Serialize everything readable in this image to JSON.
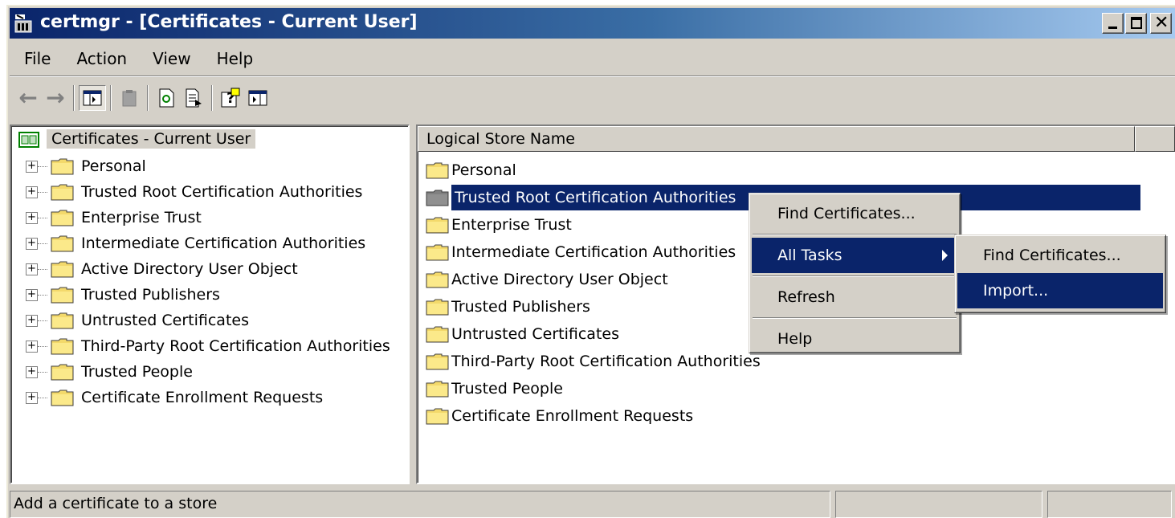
{
  "window": {
    "title": "certmgr - [Certificates - Current User]",
    "icons": {
      "app": "certmgr-icon",
      "minimize": "minimize-icon",
      "maximize": "maximize-icon",
      "close": "close-icon"
    },
    "close_glyph": "✕"
  },
  "menu": [
    "File",
    "Action",
    "View",
    "Help"
  ],
  "toolbar": {
    "buttons": [
      "back-icon",
      "forward-icon",
      "show-hide-console-tree-icon",
      "delete-icon",
      "refresh-icon",
      "export-list-icon",
      "help-icon",
      "show-hide-action-pane-icon"
    ],
    "back_glyph": "←",
    "forward_glyph": "→"
  },
  "tree": {
    "root": "Certificates - Current User",
    "expander_glyph": "+",
    "items": [
      "Personal",
      "Trusted Root Certification Authorities",
      "Enterprise Trust",
      "Intermediate Certification Authorities",
      "Active Directory User Object",
      "Trusted Publishers",
      "Untrusted Certificates",
      "Third-Party Root Certification Authorities",
      "Trusted People",
      "Certificate Enrollment Requests"
    ]
  },
  "list": {
    "column_header": "Logical Store Name",
    "items": [
      "Personal",
      "Trusted Root Certification Authorities",
      "Enterprise Trust",
      "Intermediate Certification Authorities",
      "Active Directory User Object",
      "Trusted Publishers",
      "Untrusted Certificates",
      "Third-Party Root Certification Authorities",
      "Trusted People",
      "Certificate Enrollment Requests"
    ]
  },
  "context_menu": {
    "find_certificates": "Find Certificates...",
    "all_tasks": "All Tasks",
    "refresh": "Refresh",
    "help": "Help"
  },
  "submenu": {
    "find_certificates": "Find Certificates...",
    "import": "Import..."
  },
  "status": {
    "text": "Add a certificate to a store"
  },
  "colors": {
    "selection": "#0a246a",
    "face": "#d4d0c8",
    "folder": "#f3d96b"
  }
}
